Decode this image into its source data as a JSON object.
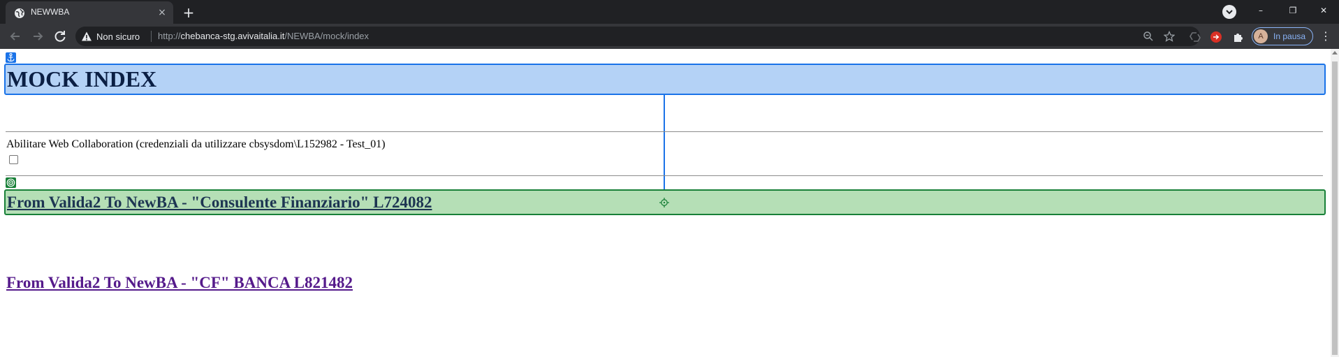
{
  "browser": {
    "tab": {
      "title": "NEWWBA",
      "favicon": "globe-icon",
      "close": "×"
    },
    "new_tab": "+",
    "window_controls": {
      "minimize": "–",
      "restore": "❐",
      "close": "✕"
    },
    "nav": {
      "back": "←",
      "forward": "→",
      "reload": "↻"
    },
    "security": {
      "icon": "warning-icon",
      "label": "Non sicuro"
    },
    "url": {
      "scheme": "http://",
      "host": "chebanca-stg.avivaitalia.it",
      "path": "/NEWBA/mock/index"
    },
    "profile": {
      "initial": "A",
      "label": "In pausa",
      "color": "#8ab4f8"
    },
    "menu": "⋮"
  },
  "page": {
    "title": "MOCK INDEX",
    "web_collaboration": {
      "label": "Abilitare Web Collaboration (credenziali da utilizzare cbsysdom\\L152982 - Test_01)",
      "checked": false
    },
    "links": [
      {
        "label": "From Valida2 To NewBA - \"Consulente Finanziario\" L724082"
      },
      {
        "label": "From Valida2 To NewBA - \"CF\" BANCA L821482"
      }
    ],
    "highlight_colors": {
      "anchor": "#1a73e8",
      "target": "#188038"
    }
  }
}
